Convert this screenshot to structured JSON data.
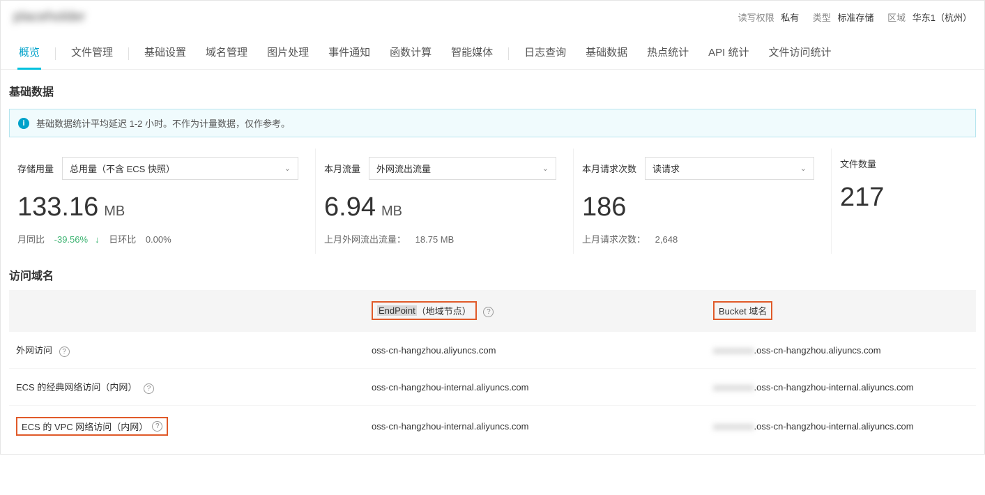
{
  "header": {
    "bucket_name": "placeholder",
    "perm_label": "读写权限",
    "perm_value": "私有",
    "type_label": "类型",
    "type_value": "标准存储",
    "region_label": "区域",
    "region_value": "华东1（杭州）"
  },
  "tabs": [
    {
      "label": "概览",
      "active": true
    },
    {
      "label": "文件管理"
    },
    {
      "label": "基础设置"
    },
    {
      "label": "域名管理"
    },
    {
      "label": "图片处理"
    },
    {
      "label": "事件通知"
    },
    {
      "label": "函数计算"
    },
    {
      "label": "智能媒体"
    },
    {
      "label": "日志查询"
    },
    {
      "label": "基础数据"
    },
    {
      "label": "热点统计"
    },
    {
      "label": "API 统计"
    },
    {
      "label": "文件访问统计"
    }
  ],
  "basic_data": {
    "title": "基础数据",
    "notice": "基础数据统计平均延迟 1-2 小时。不作为计量数据，仅作参考。"
  },
  "metrics": {
    "storage": {
      "label": "存储用量",
      "select": "总用量（不含 ECS 快照）",
      "value": "133.16",
      "unit": "MB",
      "sub1_label": "月同比",
      "sub1_value": "-39.56%",
      "sub1_arrow": "↓",
      "sub2_label": "日环比",
      "sub2_value": "0.00%"
    },
    "traffic": {
      "label": "本月流量",
      "select": "外网流出流量",
      "value": "6.94",
      "unit": "MB",
      "sub_label": "上月外网流出流量：",
      "sub_value": "18.75 MB"
    },
    "requests": {
      "label": "本月请求次数",
      "select": "读请求",
      "value": "186",
      "sub_label": "上月请求次数：",
      "sub_value": "2,648"
    },
    "files": {
      "label": "文件数量",
      "value": "217"
    }
  },
  "domain": {
    "title": "访问域名",
    "col_endpoint": "EndPoint",
    "col_endpoint_suffix": "（地域节点）",
    "col_bucket": "Bucket 域名",
    "rows": [
      {
        "name": "外网访问",
        "endpoint": "oss-cn-hangzhou.aliyuncs.com",
        "bucket_suffix": ".oss-cn-hangzhou.aliyuncs.com",
        "highlight": false
      },
      {
        "name": "ECS 的经典网络访问（内网）",
        "endpoint": "oss-cn-hangzhou-internal.aliyuncs.com",
        "bucket_suffix": ".oss-cn-hangzhou-internal.aliyuncs.com",
        "highlight": false
      },
      {
        "name": "ECS 的 VPC 网络访问（内网）",
        "endpoint": "oss-cn-hangzhou-internal.aliyuncs.com",
        "bucket_suffix": ".oss-cn-hangzhou-internal.aliyuncs.com",
        "highlight": true
      }
    ],
    "blurred_prefix": "xxxxxxxxx"
  }
}
